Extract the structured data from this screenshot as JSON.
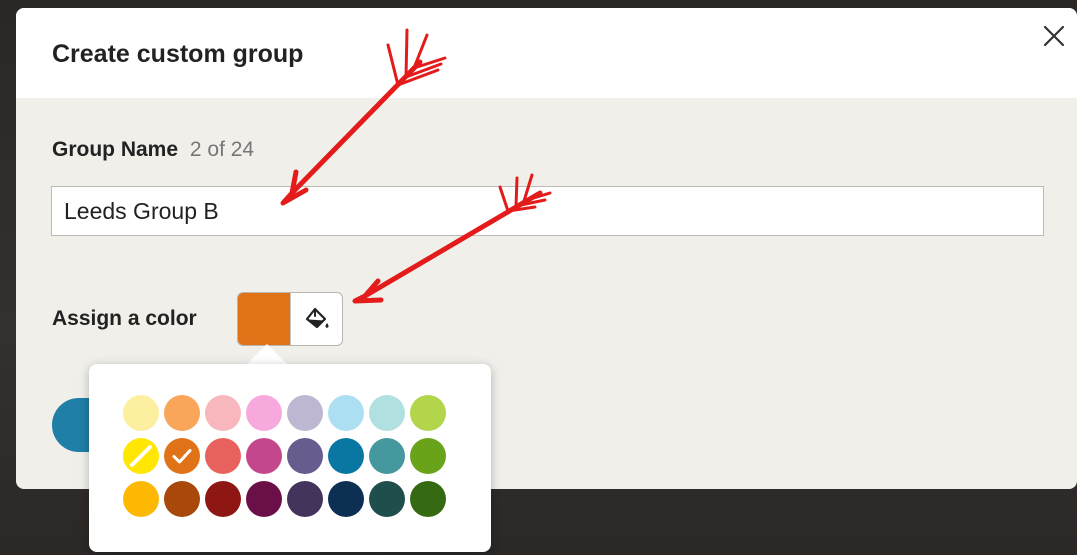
{
  "dialog": {
    "title": "Create custom group",
    "close_icon": "close-icon"
  },
  "group_name": {
    "label": "Group Name",
    "count": "2 of 24",
    "value": "Leeds Group B"
  },
  "assign_color": {
    "label": "Assign a color",
    "selected_color": "#E07318",
    "icon": "paint-bucket-icon"
  },
  "palette": {
    "rows": [
      [
        "#FCEFA0",
        "#F9A65A",
        "#F8B7BC",
        "#F7A9DE",
        "#BDB7D2",
        "#ACDFF1",
        "#B1E0E1",
        "#B2D54C"
      ],
      [
        "none",
        "#E07318",
        "#E8625D",
        "#C4478D",
        "#665D8E",
        "#0A77A3",
        "#45999E",
        "#68A31A"
      ],
      [
        "#FDB804",
        "#A8480A",
        "#8E1714",
        "#6A0F47",
        "#42345A",
        "#0D2F54",
        "#1F4F4D",
        "#356A12"
      ]
    ],
    "selected": "#E07318",
    "no_color_icon": "no-color-slash-icon",
    "check_icon": "check-icon"
  },
  "annotation_color": "#E31B1B",
  "accent_color": "#1F7FA6"
}
